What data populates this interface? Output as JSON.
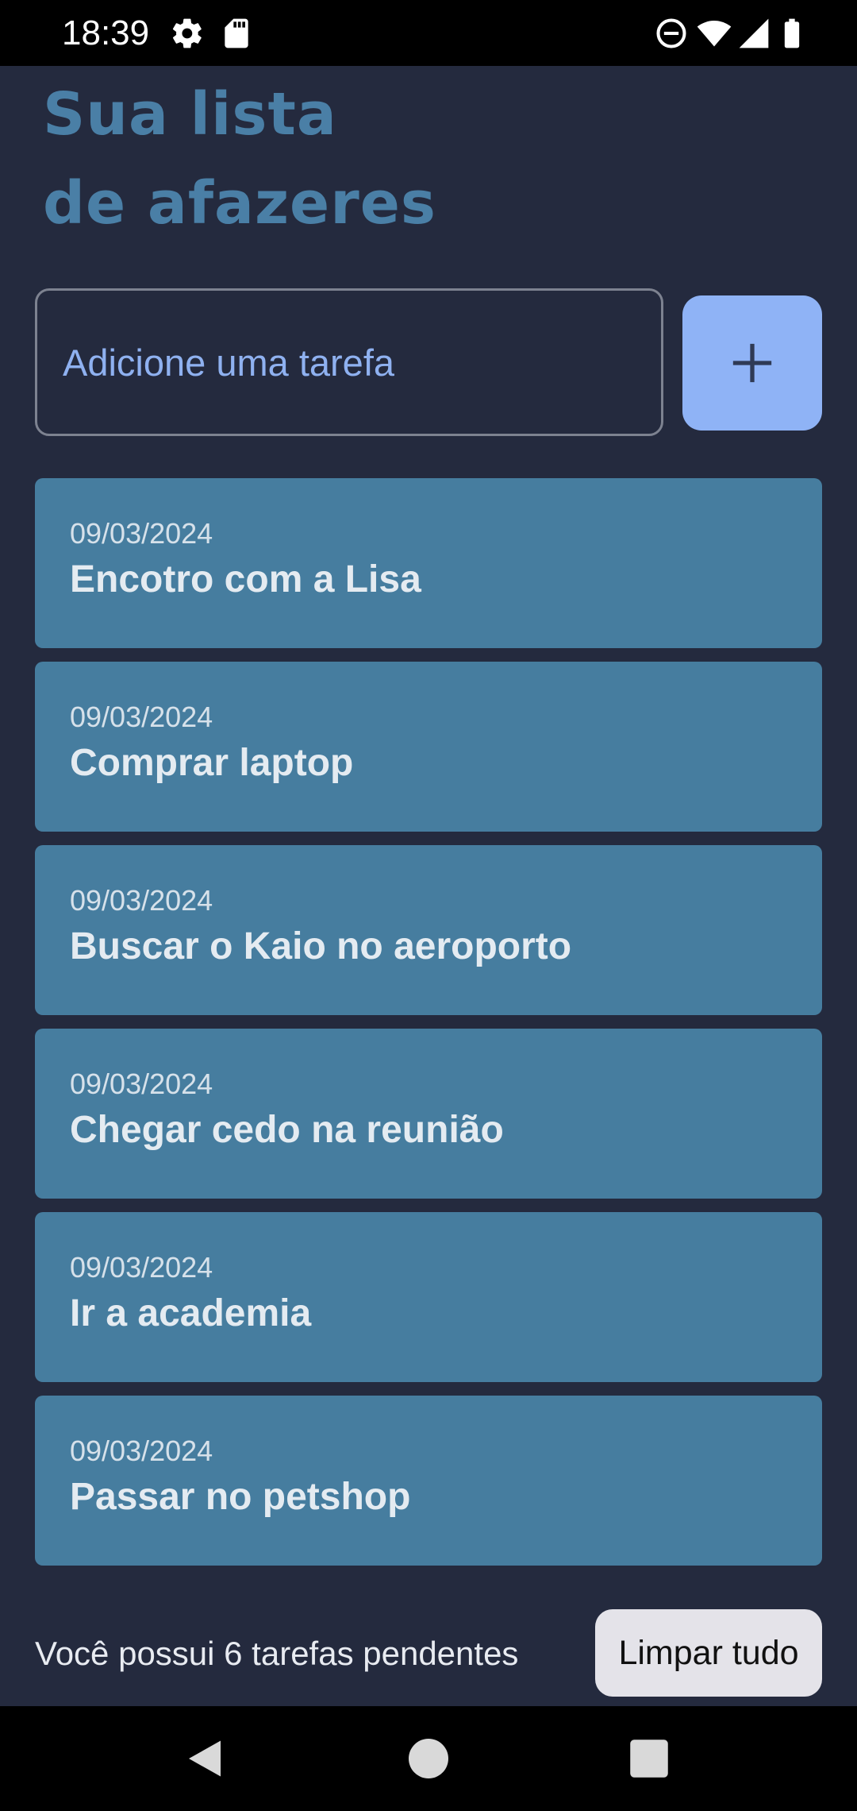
{
  "status_bar": {
    "time": "18:39",
    "left_icons": [
      "settings-icon",
      "sd-card-icon"
    ],
    "right_icons": [
      "do-not-disturb-icon",
      "wifi-icon",
      "signal-icon",
      "battery-icon"
    ]
  },
  "header": {
    "title_line1": "Sua lista",
    "title_line2": "de afazeres"
  },
  "input": {
    "placeholder": "Adicione uma tarefa",
    "value": ""
  },
  "add_button": {
    "icon": "plus-icon"
  },
  "tasks": [
    {
      "date": "09/03/2024",
      "title": "Encotro com a Lisa"
    },
    {
      "date": "09/03/2024",
      "title": "Comprar laptop"
    },
    {
      "date": "09/03/2024",
      "title": "Buscar o Kaio no aeroporto"
    },
    {
      "date": "09/03/2024",
      "title": "Chegar cedo na reunião"
    },
    {
      "date": "09/03/2024",
      "title": "Ir a academia"
    },
    {
      "date": "09/03/2024",
      "title": "Passar no petshop"
    }
  ],
  "footer": {
    "pending_text": "Você possui 6 tarefas pendentes",
    "clear_label": "Limpar tudo"
  },
  "nav_bar": {
    "buttons": [
      "back-icon",
      "home-icon",
      "recents-icon"
    ]
  },
  "colors": {
    "background": "#242a3e",
    "title": "#4a7fa6",
    "card": "#467d9f",
    "accent": "#8fb3f6",
    "placeholder": "#8fb1f0",
    "clear_button": "#e4e3e9"
  }
}
